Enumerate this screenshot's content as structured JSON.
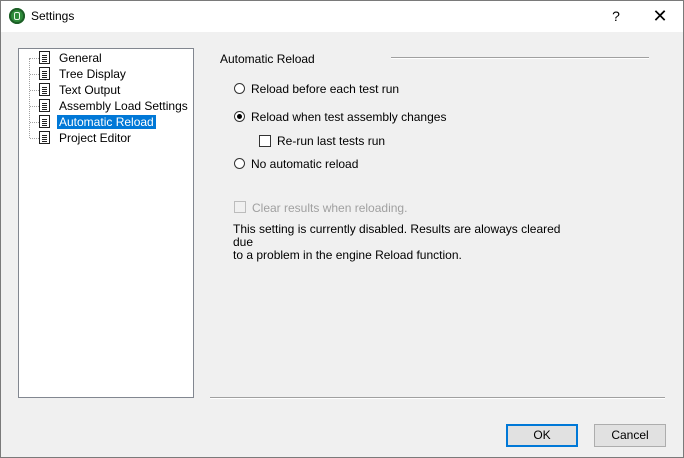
{
  "window": {
    "title": "Settings",
    "help_glyph": "?",
    "close_glyph": "✕"
  },
  "tree": {
    "items": [
      {
        "label": "General"
      },
      {
        "label": "Tree Display"
      },
      {
        "label": "Text Output"
      },
      {
        "label": "Assembly Load Settings"
      },
      {
        "label": "Automatic Reload",
        "selected": true
      },
      {
        "label": "Project Editor"
      }
    ]
  },
  "panel": {
    "group_title": "Automatic Reload",
    "options": {
      "reload_before": {
        "label": "Reload before each test run",
        "checked": false
      },
      "reload_on_change": {
        "label": "Reload when test assembly changes",
        "checked": true
      },
      "rerun_last": {
        "label": "Re-run last tests run",
        "checked": false
      },
      "no_reload": {
        "label": "No automatic reload",
        "checked": false
      },
      "clear_results": {
        "label": "Clear results when reloading.",
        "checked": false,
        "disabled": true
      }
    },
    "note": "This setting is currently disabled. Results are aloways cleared due\nto  a problem in the engine Reload function."
  },
  "buttons": {
    "ok": "OK",
    "cancel": "Cancel"
  }
}
